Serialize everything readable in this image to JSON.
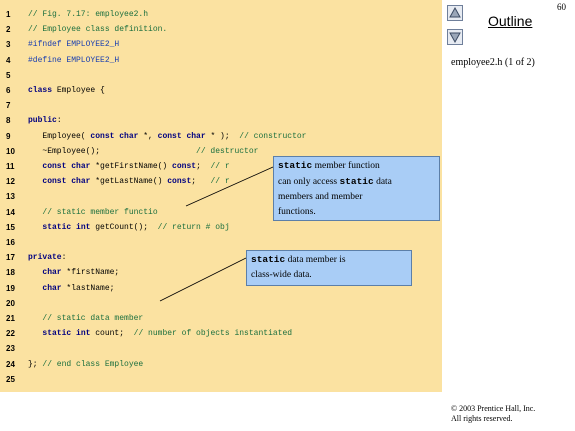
{
  "page_number": "60",
  "outline": {
    "title": "Outline",
    "file_label": "employee2.h (1 of 2)"
  },
  "nav": {
    "up_icon": "triangle-up-icon",
    "down_icon": "triangle-down-icon"
  },
  "code_lines": [
    {
      "n": "1",
      "segments": [
        {
          "t": "// Fig. 7.17: employee2.h",
          "c": "comment"
        }
      ]
    },
    {
      "n": "2",
      "segments": [
        {
          "t": "// Employee class definition.",
          "c": "comment"
        }
      ]
    },
    {
      "n": "3",
      "segments": [
        {
          "t": "#ifndef EMPLOYEE2_H",
          "c": "pp"
        }
      ]
    },
    {
      "n": "4",
      "segments": [
        {
          "t": "#define EMPLOYEE2_H",
          "c": "pp"
        }
      ]
    },
    {
      "n": "5",
      "segments": []
    },
    {
      "n": "6",
      "segments": [
        {
          "t": "class",
          "c": "kw"
        },
        {
          "t": " Employee {",
          "c": ""
        }
      ]
    },
    {
      "n": "7",
      "segments": []
    },
    {
      "n": "8",
      "segments": [
        {
          "t": "public",
          "c": "kw"
        },
        {
          "t": ":",
          "c": ""
        }
      ]
    },
    {
      "n": "9",
      "segments": [
        {
          "t": "   Employee( ",
          "c": ""
        },
        {
          "t": "const char",
          "c": "kw"
        },
        {
          "t": " *, ",
          "c": ""
        },
        {
          "t": "const char",
          "c": "kw"
        },
        {
          "t": " * );  ",
          "c": ""
        },
        {
          "t": "// constructor",
          "c": "comment"
        }
      ]
    },
    {
      "n": "10",
      "segments": [
        {
          "t": "   ~Employee();                    ",
          "c": ""
        },
        {
          "t": "// destructor",
          "c": "comment"
        }
      ]
    },
    {
      "n": "11",
      "segments": [
        {
          "t": "   ",
          "c": ""
        },
        {
          "t": "const char",
          "c": "kw"
        },
        {
          "t": " *getFirstName() ",
          "c": ""
        },
        {
          "t": "const",
          "c": "kw"
        },
        {
          "t": ";  ",
          "c": ""
        },
        {
          "t": "// r",
          "c": "comment"
        }
      ]
    },
    {
      "n": "12",
      "segments": [
        {
          "t": "   ",
          "c": ""
        },
        {
          "t": "const char",
          "c": "kw"
        },
        {
          "t": " *getLastName() ",
          "c": ""
        },
        {
          "t": "const",
          "c": "kw"
        },
        {
          "t": ";   ",
          "c": ""
        },
        {
          "t": "// r",
          "c": "comment"
        }
      ]
    },
    {
      "n": "13",
      "segments": []
    },
    {
      "n": "14",
      "segments": [
        {
          "t": "   // static member functio",
          "c": "comment"
        }
      ]
    },
    {
      "n": "15",
      "segments": [
        {
          "t": "   ",
          "c": ""
        },
        {
          "t": "static int",
          "c": "kw"
        },
        {
          "t": " getCount();  ",
          "c": ""
        },
        {
          "t": "// return # obj",
          "c": "comment"
        }
      ]
    },
    {
      "n": "16",
      "segments": []
    },
    {
      "n": "17",
      "segments": [
        {
          "t": "private",
          "c": "kw"
        },
        {
          "t": ":",
          "c": ""
        }
      ]
    },
    {
      "n": "18",
      "segments": [
        {
          "t": "   ",
          "c": ""
        },
        {
          "t": "char",
          "c": "kw"
        },
        {
          "t": " *firstName;",
          "c": ""
        }
      ]
    },
    {
      "n": "19",
      "segments": [
        {
          "t": "   ",
          "c": ""
        },
        {
          "t": "char",
          "c": "kw"
        },
        {
          "t": " *lastName;",
          "c": ""
        }
      ]
    },
    {
      "n": "20",
      "segments": []
    },
    {
      "n": "21",
      "segments": [
        {
          "t": "   // static data member",
          "c": "comment"
        }
      ]
    },
    {
      "n": "22",
      "segments": [
        {
          "t": "   ",
          "c": ""
        },
        {
          "t": "static int",
          "c": "kw"
        },
        {
          "t": " count;  ",
          "c": ""
        },
        {
          "t": "// number of objects instantiated",
          "c": "comment"
        }
      ]
    },
    {
      "n": "23",
      "segments": []
    },
    {
      "n": "24",
      "segments": [
        {
          "t": "}; ",
          "c": ""
        },
        {
          "t": "// end class Employee",
          "c": "comment"
        }
      ]
    },
    {
      "n": "25",
      "segments": []
    }
  ],
  "callouts": {
    "member_function": {
      "keyword": "static",
      "rest_line1": " member function",
      "line2_a": "can only access ",
      "line2_keyword": "static",
      "line2_b": " data",
      "line3": "members and member",
      "line4": "functions."
    },
    "data_member": {
      "keyword": "static",
      "rest_line1": " data member is",
      "line2": "class-wide data."
    }
  },
  "copyright": {
    "line1": "© 2003 Prentice Hall, Inc.",
    "line2": "All rights reserved."
  }
}
